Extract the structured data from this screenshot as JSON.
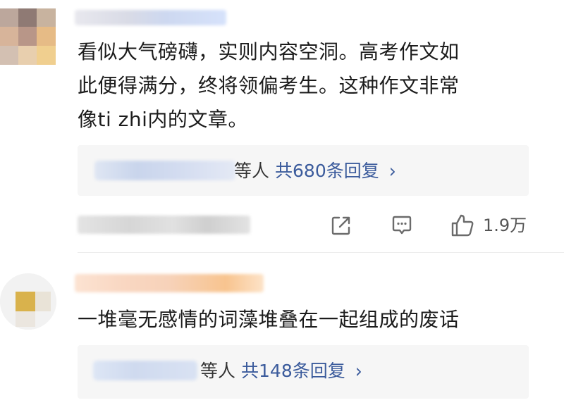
{
  "comments": [
    {
      "text_lines": [
        "看似大气磅礴，实则内容空洞。高考作文如",
        "此便得满分，终将领偏考生。这种作文非常",
        "像ti zhi内的文章。"
      ],
      "reply_summary": {
        "suffix": "等人",
        "count_text": "共680条回复",
        "chevron": "›"
      },
      "actions": {
        "share_icon": "share-icon",
        "comment_icon": "comment-icon",
        "like_icon": "thumbs-up-icon",
        "like_count": "1.9万"
      }
    },
    {
      "text_lines": [
        "一堆毫无感情的词藻堆叠在一起组成的废话"
      ],
      "reply_summary": {
        "suffix": "等人",
        "count_text": "共148条回复",
        "chevron": "›"
      }
    }
  ],
  "colors": {
    "link_blue": "#3b5b9c",
    "text": "#1c1c1c",
    "icon_gray": "#6b6b6b",
    "reply_bg": "#f6f6f6"
  }
}
